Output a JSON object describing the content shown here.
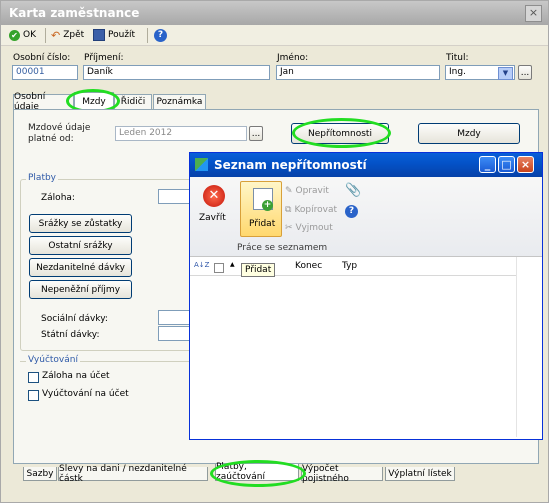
{
  "window": {
    "title": "Karta zaměstnance",
    "close_glyph": "×"
  },
  "toolbar": {
    "ok": "OK",
    "back": "Zpět",
    "apply": "Použít",
    "help_glyph": "?"
  },
  "form": {
    "personal_number_label": "Osobní číslo:",
    "personal_number": "00001",
    "surname_label": "Příjmení:",
    "surname": "Daník",
    "name_label": "Jméno:",
    "name": "Jan",
    "title_label": "Titul:",
    "title_value": "Ing.",
    "ellipsis": "..."
  },
  "tabs": [
    "Osobní údaje",
    "Mzdy",
    "Řidiči",
    "Poznámka"
  ],
  "mzdy": {
    "valid_from_label_1": "Mzdové údaje",
    "valid_from_label_2": "platné od:",
    "valid_from_value": "Leden 2012",
    "absence_button": "Nepřítomnosti",
    "wages_button": "Mzdy"
  },
  "payments": {
    "legend": "Platby",
    "advance_label": "Záloha:",
    "buttons": [
      "Srážky se zůstatky",
      "Ostatní srážky",
      "Nezdanitelné dávky",
      "Nepeněžní příjmy"
    ],
    "social_label": "Sociální dávky:",
    "state_label": "Státní dávky:"
  },
  "settlement": {
    "legend": "Vyúčtování",
    "checks": [
      "Záloha na účet",
      "Vyúčtování na účet"
    ]
  },
  "bottom_tabs": [
    "Sazby",
    "Slevy na dani / nezdanitelné částk",
    "Platby, zaúčtování",
    "Výpočet pojistného",
    "Výplatní lístek"
  ],
  "dialog": {
    "title": "Seznam nepřítomností",
    "close_label": "Zavřít",
    "add_label": "Přidat",
    "edit_label": "Opravit",
    "copy_label": "Kopírovat",
    "cut_label": "Vyjmout",
    "group_label": "Práce se seznamem",
    "tooltip": "Přidat",
    "columns": [
      "Konec",
      "Typ"
    ],
    "sort_glyph": "A↓Z"
  }
}
